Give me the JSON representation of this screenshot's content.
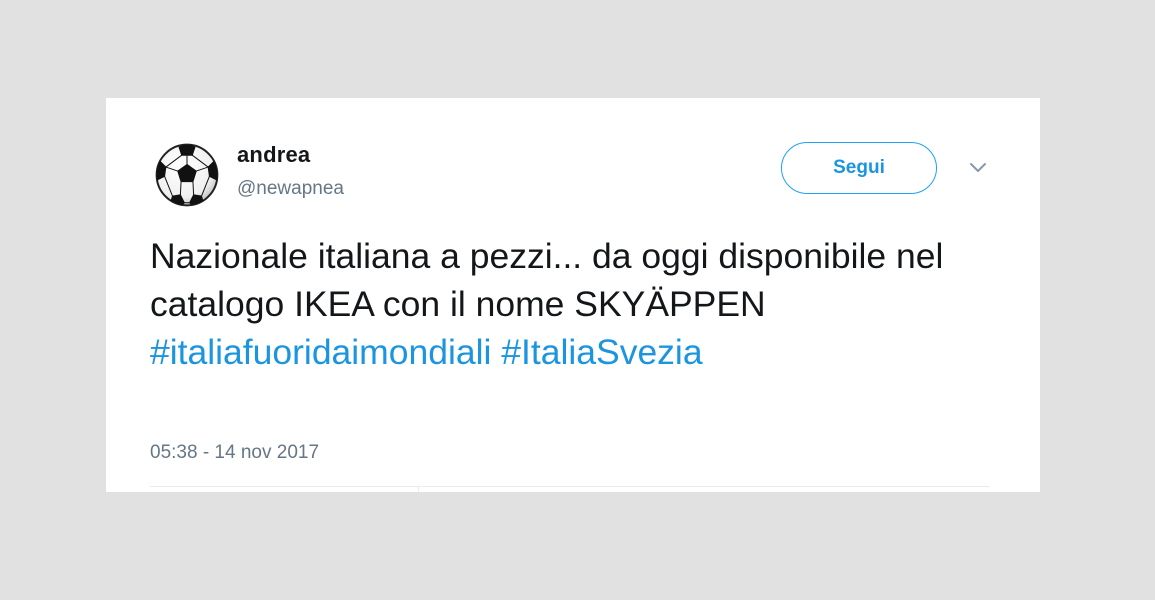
{
  "user": {
    "display_name": "andrea",
    "handle": "@newapnea",
    "avatar_icon": "soccer-ball-icon"
  },
  "actions": {
    "follow_label": "Segui",
    "menu_icon": "chevron-down-icon"
  },
  "tweet": {
    "text_line": "Nazionale italiana a pezzi... da oggi disponibile nel catalogo IKEA con il nome SKYÄPPEN ",
    "hashtags": [
      "#italiafuoridaimondiali",
      "#ItaliaSvezia"
    ],
    "timestamp": "05:38 - 14 nov 2017"
  },
  "colors": {
    "accent": "#1b95e0",
    "text": "#14171a",
    "muted": "#657786",
    "background": "#e1e1e1",
    "card": "#ffffff"
  }
}
